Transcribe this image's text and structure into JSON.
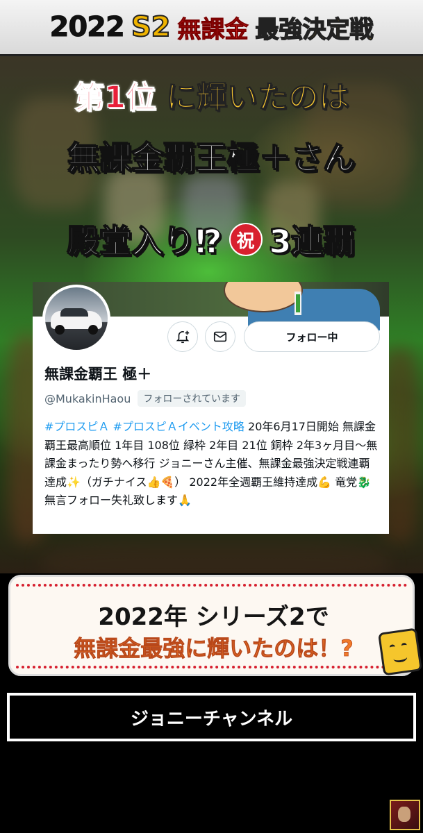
{
  "banner": {
    "year": "2022",
    "season": "S2",
    "mukakin": "無課金",
    "saikyo": "最強決定戦"
  },
  "overlay": {
    "rank": "第1位",
    "rank_rest": "に輝いたのは",
    "winner": "無課金覇王極＋さん",
    "hall_of_fame": "殿堂入り⁉︎",
    "iwai": "祝",
    "streak": "3連覇"
  },
  "profile": {
    "display_name": "無課金覇王 極＋",
    "handle": "@MukakinHaou",
    "follows_you": "フォローされています",
    "follow_button": "フォロー中",
    "bio_tag1": "#プロスピＡ",
    "bio_tag2": "#プロスピＡイベント攻略",
    "bio_text": " 20年6月17日開始 無課金 覇王最高順位 1年目 108位 緑枠 2年目 21位 銅枠 2年3ヶ月目～無課金まったり勢へ移行 ジョニーさん主催、無課金最強決定戦連覇達成✨（ガチナイス👍🍕） 2022年全週覇王維持達成💪 竜党🐉 無言フォロー失礼致します🙏"
  },
  "caption": {
    "line1": "2022年 シリーズ2で",
    "line2": "無課金最強に輝いたのは！?"
  },
  "channel": {
    "name": "ジョニーチャンネル"
  },
  "colors": {
    "accent_red": "#e8203a",
    "accent_gold": "#f5c531",
    "link_blue": "#1d9bf0",
    "caption_orange": "#f07a2a"
  }
}
